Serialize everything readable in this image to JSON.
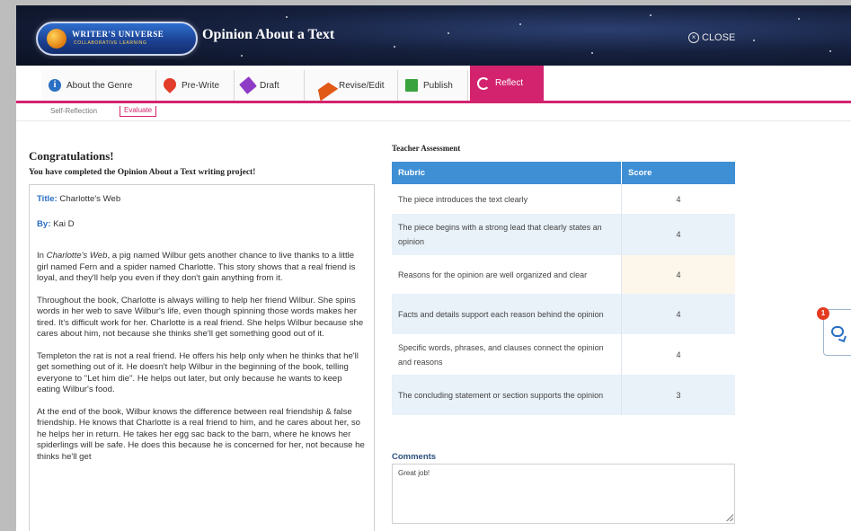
{
  "header": {
    "logo_text": "WRITER'S UNIVERSE",
    "logo_sub": "COLLABORATIVE LEARNING",
    "title": "Opinion About a Text",
    "close_label": "CLOSE"
  },
  "tabs": [
    {
      "label": "About the Genre",
      "icon": "info-icon"
    },
    {
      "label": "Pre-Write",
      "icon": "pin-icon"
    },
    {
      "label": "Draft",
      "icon": "pencil-icon"
    },
    {
      "label": "Revise/Edit",
      "icon": "cursor-icon"
    },
    {
      "label": "Publish",
      "icon": "book-icon"
    },
    {
      "label": "Reflect",
      "icon": "reflect-icon",
      "active": true
    }
  ],
  "subtabs": [
    {
      "label": "Self-Reflection"
    },
    {
      "label": "Evaluate",
      "active": true
    }
  ],
  "left": {
    "congrats": "Congratulations!",
    "completed": "You have completed the Opinion About a Text writing project!",
    "title_label": "Title:",
    "title_value": "Charlotte's Web",
    "by_label": "By:",
    "by_value": "Kai D",
    "paragraphs": {
      "p1_italic": "Charlotte's Web",
      "p1_lead": "In ",
      "p1_rest": ", a pig named Wilbur gets another chance to live thanks to a little girl named Fern and a spider named Charlotte. This story shows that a real friend is loyal, and they'll help you even if they don't gain anything from it.",
      "p2": "Throughout the book, Charlotte is always willing to help her friend Wilbur. She spins words in her web to save Wilbur's life, even though spinning those words makes her tired. It's difficult work for her. Charlotte is a real friend. She helps Wilbur because she cares about him, not because she thinks she'll get something good out of it.",
      "p3": "Templeton the rat is not a real friend. He offers his help only when he thinks that he'll get something out of it. He doesn't help Wilbur in the beginning of the book, telling everyone to \"Let him die\". He helps out later, but only because he wants to keep eating Wilbur's food.",
      "p4": "At the end of the book, Wilbur knows the difference between real friendship & false friendship. He knows that Charlotte is a real friend to him, and he cares about her, so he helps her in return. He takes her egg sac back to the barn, where he knows her spiderlings will be safe. He does this because he is concerned for her, not because he thinks he'll get"
    }
  },
  "assessment": {
    "heading": "Teacher Assessment",
    "col_rubric": "Rubric",
    "col_score": "Score",
    "rows": [
      {
        "criterion": "The piece introduces the text clearly",
        "score": "4"
      },
      {
        "criterion": "The piece begins with a strong lead that clearly states an opinion",
        "score": "4"
      },
      {
        "criterion": "Reasons for the opinion are well organized and clear",
        "score": "4"
      },
      {
        "criterion": "Facts and details support each reason behind the opinion",
        "score": "4"
      },
      {
        "criterion": "Specific words, phrases, and clauses connect the opinion and reasons",
        "score": "4"
      },
      {
        "criterion": "The concluding statement or section supports the opinion",
        "score": "3"
      }
    ],
    "comments_label": "Comments",
    "comments_value": "Great job!"
  },
  "chat": {
    "badge_count": "1",
    "icon": "chat-icon"
  },
  "colors": {
    "accent": "#d3236e",
    "table_header": "#3f8fd4",
    "link_blue": "#2a6fc4"
  }
}
